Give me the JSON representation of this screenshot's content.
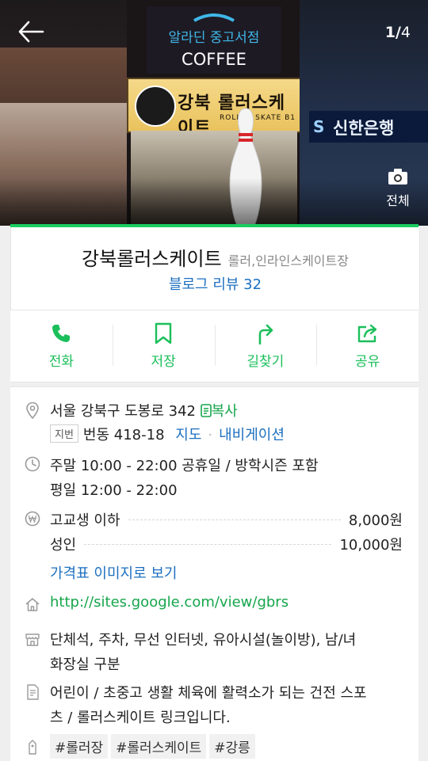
{
  "gallery": {
    "current": "1",
    "separator": "/",
    "total": "4",
    "all_photos_label": "전체",
    "signs": {
      "coffee_top": "알라딘 중고서점",
      "coffee_bottom": "COFFEE",
      "skate": "강북 롤러스케이트",
      "skate_sub": "ROLLER SKATE B1",
      "bank": "신한은행"
    }
  },
  "place": {
    "name": "강북롤러스케이트",
    "category": "롤러,인라인스케이트장",
    "blog_review": "블로그 리뷰 32"
  },
  "actions": [
    {
      "label": "전화",
      "icon": "phone-icon"
    },
    {
      "label": "저장",
      "icon": "bookmark-icon"
    },
    {
      "label": "길찾기",
      "icon": "directions-icon"
    },
    {
      "label": "공유",
      "icon": "share-icon"
    }
  ],
  "info": {
    "address": "서울 강북구 도봉로 342",
    "copy_label": "복사",
    "jibun_tag": "지번",
    "jibun": "번동 418-18",
    "map_link": "지도",
    "nav_link": "내비게이션",
    "hours_1": "주말 10:00 - 22:00 공휴일 / 방학시즌 포함",
    "hours_2": "평일 12:00 - 22:00",
    "prices": [
      {
        "label": "고교생 이하",
        "value": "8,000원"
      },
      {
        "label": "성인",
        "value": "10,000원"
      }
    ],
    "price_image_link": "가격표 이미지로 보기",
    "website": "http://sites.google.com/view/gbrs",
    "facilities_1": "단체석, 주차, 무선 인터넷, 유아시설(놀이방), 남/녀",
    "facilities_2": "화장실 구분",
    "description_1": "어린이 / 초중고 생활 체육에 활력소가 되는 건전 스포",
    "description_2": "츠 / 롤러스케이트 링크입니다.",
    "tags": [
      "#롤러장",
      "#롤러스케이트",
      "#강릉"
    ]
  },
  "colors": {
    "accent": "#19ce60",
    "link": "#1c6fc0"
  }
}
